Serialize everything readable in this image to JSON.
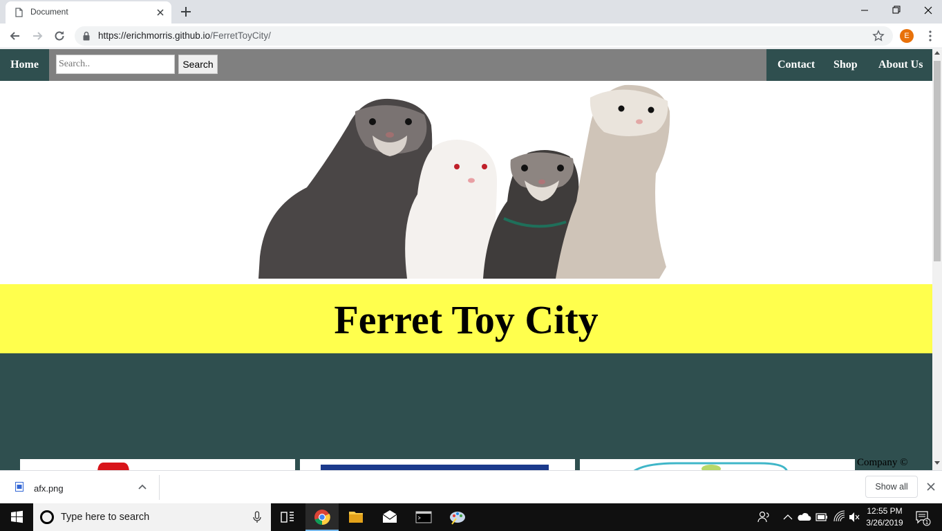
{
  "browser": {
    "tab_title": "Document",
    "url_host": "https://erichmorris.github.io",
    "url_path": "/FerretToyCity/",
    "profile_initial": "E"
  },
  "site": {
    "nav": {
      "home": "Home",
      "search_placeholder": "Search..",
      "search_button": "Search",
      "contact": "Contact",
      "shop": "Shop",
      "about": "About Us"
    },
    "title": "Ferret Toy City",
    "footer_text": "Company ©"
  },
  "downloads": {
    "file_name": "afx.png",
    "show_all": "Show all"
  },
  "taskbar": {
    "search_placeholder": "Type here to search",
    "time": "12:55 PM",
    "date": "3/26/2019",
    "notification_count": "1"
  },
  "colors": {
    "nav_accent": "#2f4f4f",
    "nav_gray": "#808080",
    "title_band": "#ffff4d"
  }
}
